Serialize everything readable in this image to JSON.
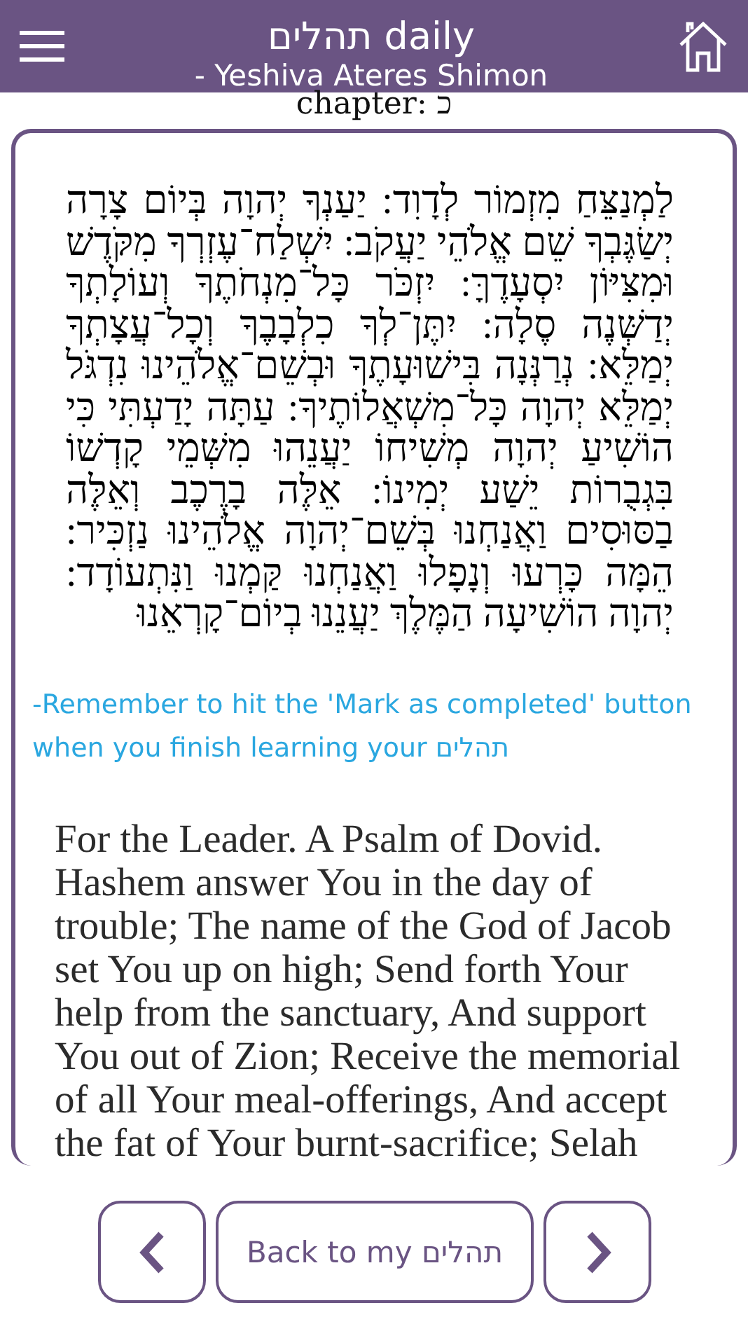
{
  "header": {
    "title": "תהלים daily",
    "subtitle": "- Yeshiva Ateres Shimon"
  },
  "chapter": {
    "label": "chapter:",
    "number": "כ"
  },
  "hebrew_text": "לַמְנַצֵּחַ מִזְמוֹר לְדָוִד: יַעַנְךָ יְהוָה בְּיוֹם צָרָה יְשַׂגֶּבְךָ שֵׁם אֱלֹהֵי יַעֲקֹב: יִשְׁלַח־עֶזְרְךָ מִקֹּדֶשׁ וּמִצִּיּוֹן יִסְעָדֶךָּ: יִזְכֹּר כָּל־מִנְחֹתֶךָ וְעוֹלָתְךָ יְדַשְּׁנֶה סֶלָה: יִתֶּן־לְךָ כִלְבָבֶךָ וְכָל־עֲצָתְךָ יְמַלֵּא: נְרַנְּנָה בִּישׁוּעָתֶךָ וּבְשֵׁם־אֱלֹהֵינוּ נִדְגֹּל יְמַלֵּא יְהוָה כָּל־מִשְׁאֲלוֹתֶיךָ: עַתָּה יָדַעְתִּי כִּי הוֹשִׁיעַ יְהוָה מְשִׁיחוֹ יַעֲנֵהוּ מִשְּׁמֵי קָדְשׁוֹ בִּגְבֻרוֹת יֵשַׁע יְמִינוֹ: אֵלֶּה בָרֶכֶב וְאֵלֶּה בַסּוּסִים וַאֲנַחְנוּ בְּשֵׁם־יְהוָה אֱלֹהֵינוּ נַזְכִּיר: הֵמָּה כָּרְעוּ וְנָפָלוּ וַאֲנַחְנוּ קַּמְנוּ וַנִּתְעוֹדָד: יְהוָה הוֹשִׁיעָה הַמֶּלֶךְ יַעֲנֵנוּ בְיוֹם־קָרְאֵנוּ",
  "note": "-Remember to hit the 'Mark as completed' button when you finish learning your תהלים",
  "english_text": "For the Leader. A Psalm of Dovid. Hashem answer You in the day of trouble; The name of the God of Jacob set You up on high; Send forth Your help from the sanctuary, And support You out of Zion; Receive the memorial of all Your meal-offerings, And accept the fat of Your burnt-sacrifice; Selah",
  "bottom_bar": {
    "back_label": "Back to my תהלים"
  }
}
